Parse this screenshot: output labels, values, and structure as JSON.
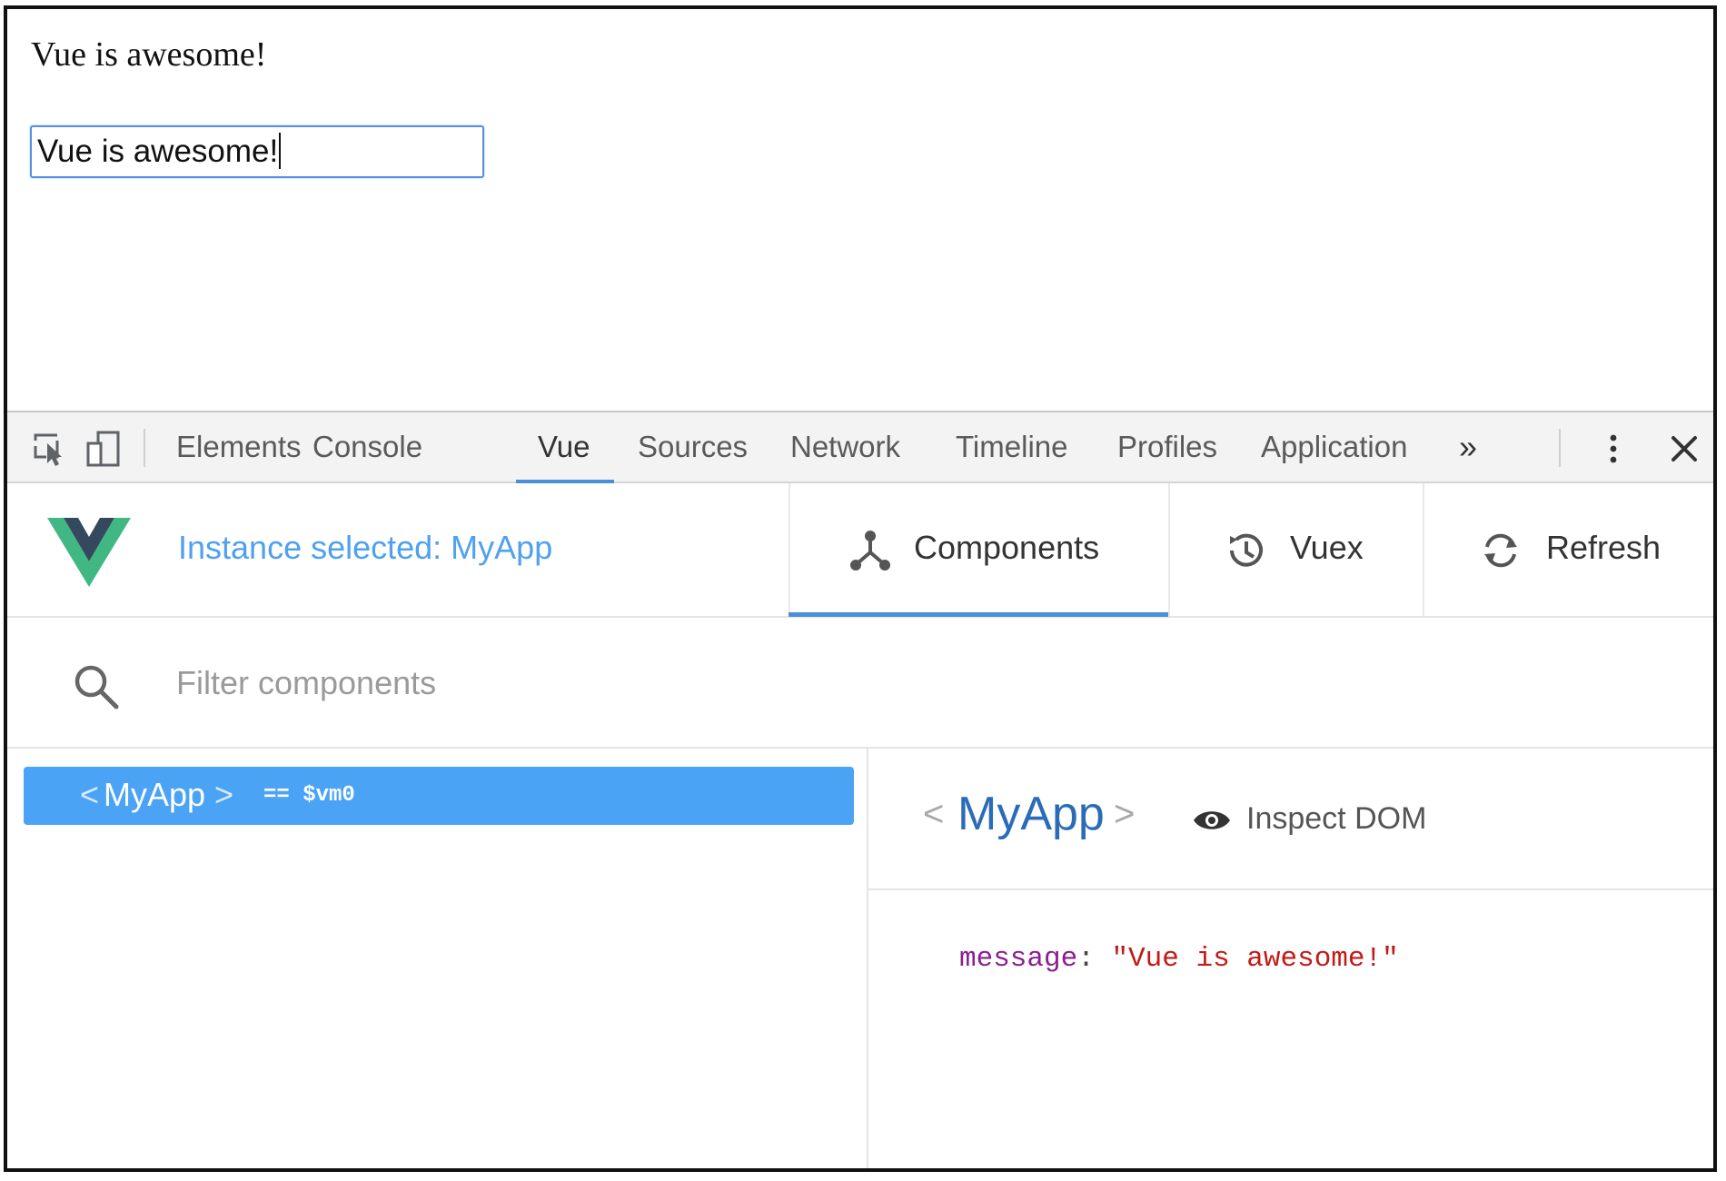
{
  "page": {
    "heading": "Vue is awesome!",
    "input_value": "Vue is awesome!"
  },
  "devtools": {
    "tabs": [
      "Elements",
      "Console",
      "Vue",
      "Sources",
      "Network",
      "Timeline",
      "Profiles",
      "Application"
    ],
    "active_tab": "Vue",
    "overflow_label": "»",
    "icons": [
      "inspect-element-icon",
      "device-toggle-icon",
      "more-vertical-icon",
      "close-icon"
    ]
  },
  "vue": {
    "instance_label": "Instance selected: MyApp",
    "components_label": "Components",
    "vuex_label": "Vuex",
    "refresh_label": "Refresh",
    "filter_placeholder": "Filter components",
    "tree": {
      "open_bracket": "<",
      "name": "MyApp",
      "close_bracket": ">",
      "vm_ref": "== $vm0"
    },
    "inspector": {
      "open_bracket": "<",
      "name": "MyApp",
      "close_bracket": ">",
      "inspect_dom_label": "Inspect DOM",
      "props": [
        {
          "key": "message",
          "value": "\"Vue is awesome!\""
        }
      ]
    }
  },
  "colors": {
    "accent_blue": "#4a90d9",
    "selected_row": "#4ba3f5",
    "vue_green": "#41b883",
    "vue_dark": "#35495e",
    "prop_key": "#8b1f8f",
    "prop_value": "#c41a16"
  }
}
